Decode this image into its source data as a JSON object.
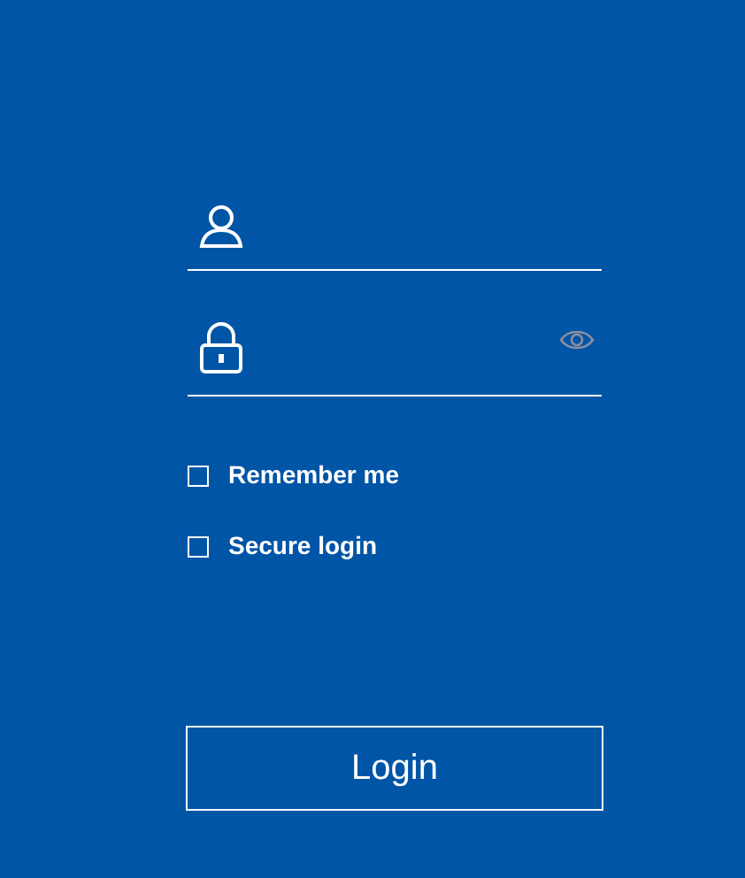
{
  "options": [
    {
      "label": "Remember me",
      "checked": false
    },
    {
      "label": "Secure login",
      "checked": false
    }
  ],
  "login_button": {
    "label": "Login"
  }
}
